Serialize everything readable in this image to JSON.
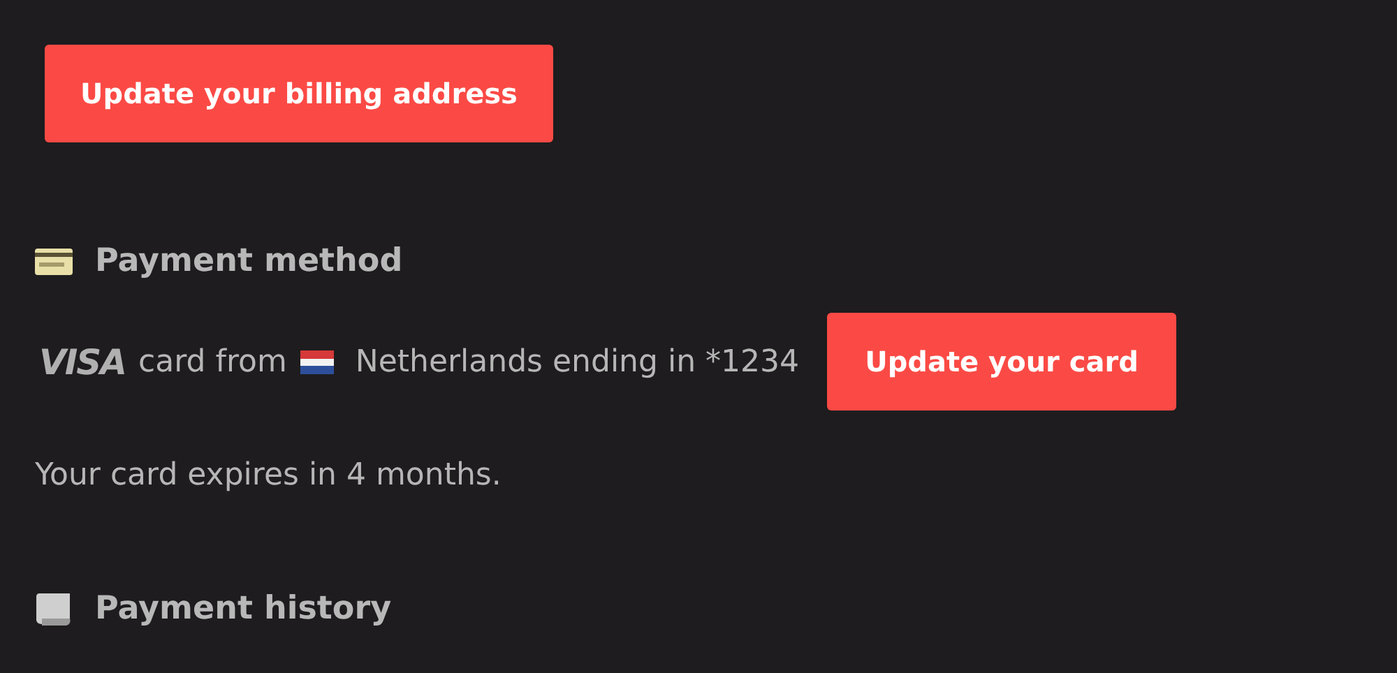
{
  "billing_button": "Update your billing address",
  "payment_method": {
    "heading": "Payment method",
    "card_brand": "VISA",
    "card_from": "card from",
    "country": "Netherlands ending in *1234",
    "update_button": "Update your card",
    "expiry": "Your card expires in 4 months."
  },
  "payment_history": {
    "heading": "Payment history"
  }
}
